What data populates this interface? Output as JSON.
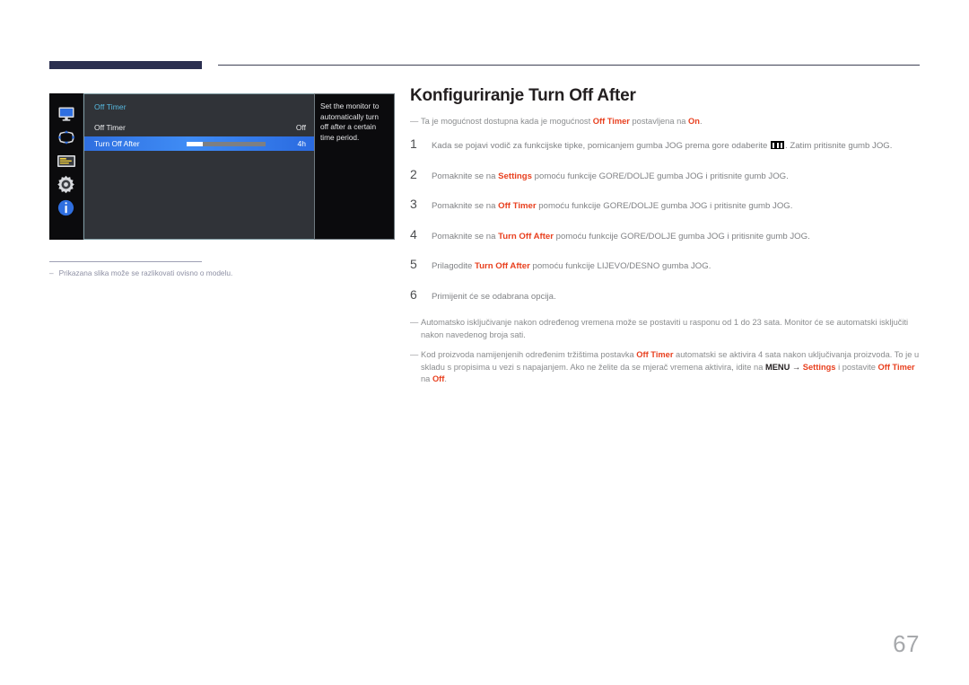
{
  "header": {
    "bar_color": "#2b2f50",
    "rule_color": "#3e4155"
  },
  "osd": {
    "title": "Off Timer",
    "rows": [
      {
        "label": "Off Timer",
        "value": "Off",
        "selected": false,
        "has_slider": false
      },
      {
        "label": "Turn Off After",
        "value": "4h",
        "selected": true,
        "has_slider": true,
        "slider_percent": 20
      }
    ],
    "help_text": "Set the monitor to automatically turn off after a certain time period.",
    "rail_icons": [
      "monitor-icon",
      "picture-size-icon",
      "onscreen-display-icon",
      "system-gear-icon",
      "information-icon"
    ],
    "selected_color": "#3f8cf5",
    "title_color": "#56b9e0",
    "panel_color": "#303338"
  },
  "figure_note": {
    "dash": "–",
    "text": "Prikazana slika može se razlikovati ovisno o modelu."
  },
  "main": {
    "title": "Konfiguriranje Turn Off After",
    "intro": {
      "dash": "—",
      "part1": "Ta je mogućnost dostupna kada je mogućnost ",
      "hl1": "Off Timer",
      "part2": " postavljena na ",
      "hl2": "On",
      "part3": "."
    },
    "steps": [
      {
        "num": "1",
        "segments": [
          {
            "type": "text",
            "value": "Kada se pojavi vodič za funkcijske tipke, pomicanjem gumba JOG prema gore odaberite "
          },
          {
            "type": "glyph",
            "value": "menu-glyph"
          },
          {
            "type": "text",
            "value": ". Zatim pritisnite gumb JOG."
          }
        ]
      },
      {
        "num": "2",
        "segments": [
          {
            "type": "text",
            "value": "Pomaknite se na "
          },
          {
            "type": "hl",
            "value": "Settings"
          },
          {
            "type": "text",
            "value": " pomoću funkcije GORE/DOLJE gumba JOG i pritisnite gumb JOG."
          }
        ]
      },
      {
        "num": "3",
        "segments": [
          {
            "type": "text",
            "value": "Pomaknite se na "
          },
          {
            "type": "hl",
            "value": "Off Timer"
          },
          {
            "type": "text",
            "value": " pomoću funkcije GORE/DOLJE gumba JOG i pritisnite gumb JOG."
          }
        ]
      },
      {
        "num": "4",
        "segments": [
          {
            "type": "text",
            "value": "Pomaknite se na "
          },
          {
            "type": "hl",
            "value": "Turn Off After"
          },
          {
            "type": "text",
            "value": " pomoću funkcije GORE/DOLJE gumba JOG i pritisnite gumb JOG."
          }
        ]
      },
      {
        "num": "5",
        "segments": [
          {
            "type": "text",
            "value": "Prilagodite "
          },
          {
            "type": "hl",
            "value": "Turn Off After"
          },
          {
            "type": "text",
            "value": " pomoću funkcije LIJEVO/DESNO gumba JOG."
          }
        ]
      },
      {
        "num": "6",
        "segments": [
          {
            "type": "text",
            "value": "Primijenit će se odabrana opcija."
          }
        ]
      }
    ],
    "footnotes": [
      {
        "dash": "—",
        "segments": [
          {
            "type": "text",
            "value": "Automatsko isključivanje nakon određenog vremena može se postaviti u rasponu od 1 do 23 sata. Monitor će se automatski isključiti nakon navedenog broja sati."
          }
        ]
      },
      {
        "dash": "—",
        "segments": [
          {
            "type": "text",
            "value": "Kod proizvoda namijenjenih određenim tržištima postavka "
          },
          {
            "type": "hl",
            "value": "Off Timer"
          },
          {
            "type": "text",
            "value": " automatski se aktivira 4 sata nakon uključivanja proizvoda. To je u skladu s propisima u vezi s napajanjem. Ako ne želite da se mjerač vremena aktivira, idite na "
          },
          {
            "type": "blk",
            "value": "MENU"
          },
          {
            "type": "arrow",
            "value": " → "
          },
          {
            "type": "hl",
            "value": "Settings"
          },
          {
            "type": "text",
            "value": " i postavite "
          },
          {
            "type": "hl",
            "value": "Off Timer"
          },
          {
            "type": "text",
            "value": " na "
          },
          {
            "type": "hl",
            "value": "Off"
          },
          {
            "type": "text",
            "value": "."
          }
        ]
      }
    ],
    "highlight_color": "#e8401f"
  },
  "page_number": "67"
}
